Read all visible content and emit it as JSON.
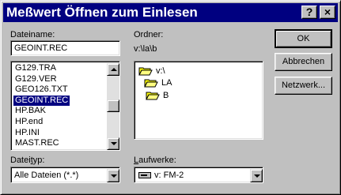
{
  "dialog": {
    "title": "Meßwert Öffnen zum Einlesen",
    "help_glyph": "?",
    "close_glyph": "×"
  },
  "filename": {
    "label": "Dateiname:",
    "value": "GEOINT.REC",
    "files": [
      "G129.TRA",
      "G129.VER",
      "GEO126.TXT",
      "GEOINT.REC",
      "HP.BAK",
      "HP.end",
      "HP.INI",
      "MAST.REC"
    ],
    "selected": "GEOINT.REC"
  },
  "folders": {
    "label": "Ordner:",
    "path": "v:\\la\\b",
    "tree": [
      "v:\\",
      "LA",
      "B"
    ]
  },
  "filetype": {
    "label": "Dateityp:",
    "value": "Alle Dateien (*.*)"
  },
  "drives": {
    "label": "Laufwerke:",
    "value": "v: FM-2"
  },
  "buttons": {
    "ok": "OK",
    "cancel": "Abbrechen",
    "network": "Netzwerk..."
  }
}
